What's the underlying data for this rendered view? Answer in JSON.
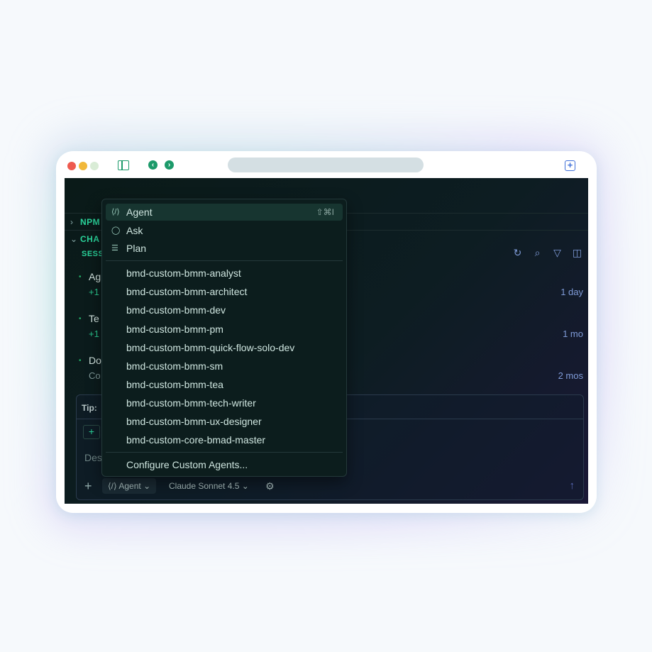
{
  "browser": {
    "back_icon": "‹",
    "forward_icon": "›",
    "new_tab_icon": "+"
  },
  "sidebar": {
    "npm_label": "NPM",
    "chat_label": "CHA",
    "sessions_label": "SESS",
    "sessions": [
      {
        "title": "Ag",
        "sub": "+1",
        "time": "1 day"
      },
      {
        "title": "Te",
        "sub": "+1",
        "time": "1 mo"
      },
      {
        "title": "Do",
        "sub": "Co",
        "time": "2 mos"
      }
    ]
  },
  "chat": {
    "tip_label": "Tip:",
    "placeholder": "Des",
    "mode_label": "Agent",
    "model_label": "Claude Sonnet 4.5"
  },
  "menu": {
    "modes": [
      {
        "label": "Agent",
        "shortcut": "⇧⌘I",
        "icon": "agent-icon",
        "selected": true
      },
      {
        "label": "Ask",
        "icon": "chat-icon",
        "selected": false
      },
      {
        "label": "Plan",
        "icon": "list-icon",
        "selected": false
      }
    ],
    "custom_agents": [
      "bmd-custom-bmm-analyst",
      "bmd-custom-bmm-architect",
      "bmd-custom-bmm-dev",
      "bmd-custom-bmm-pm",
      "bmd-custom-bmm-quick-flow-solo-dev",
      "bmd-custom-bmm-sm",
      "bmd-custom-bmm-tea",
      "bmd-custom-bmm-tech-writer",
      "bmd-custom-bmm-ux-designer",
      "bmd-custom-core-bmad-master"
    ],
    "configure_label": "Configure Custom Agents..."
  }
}
